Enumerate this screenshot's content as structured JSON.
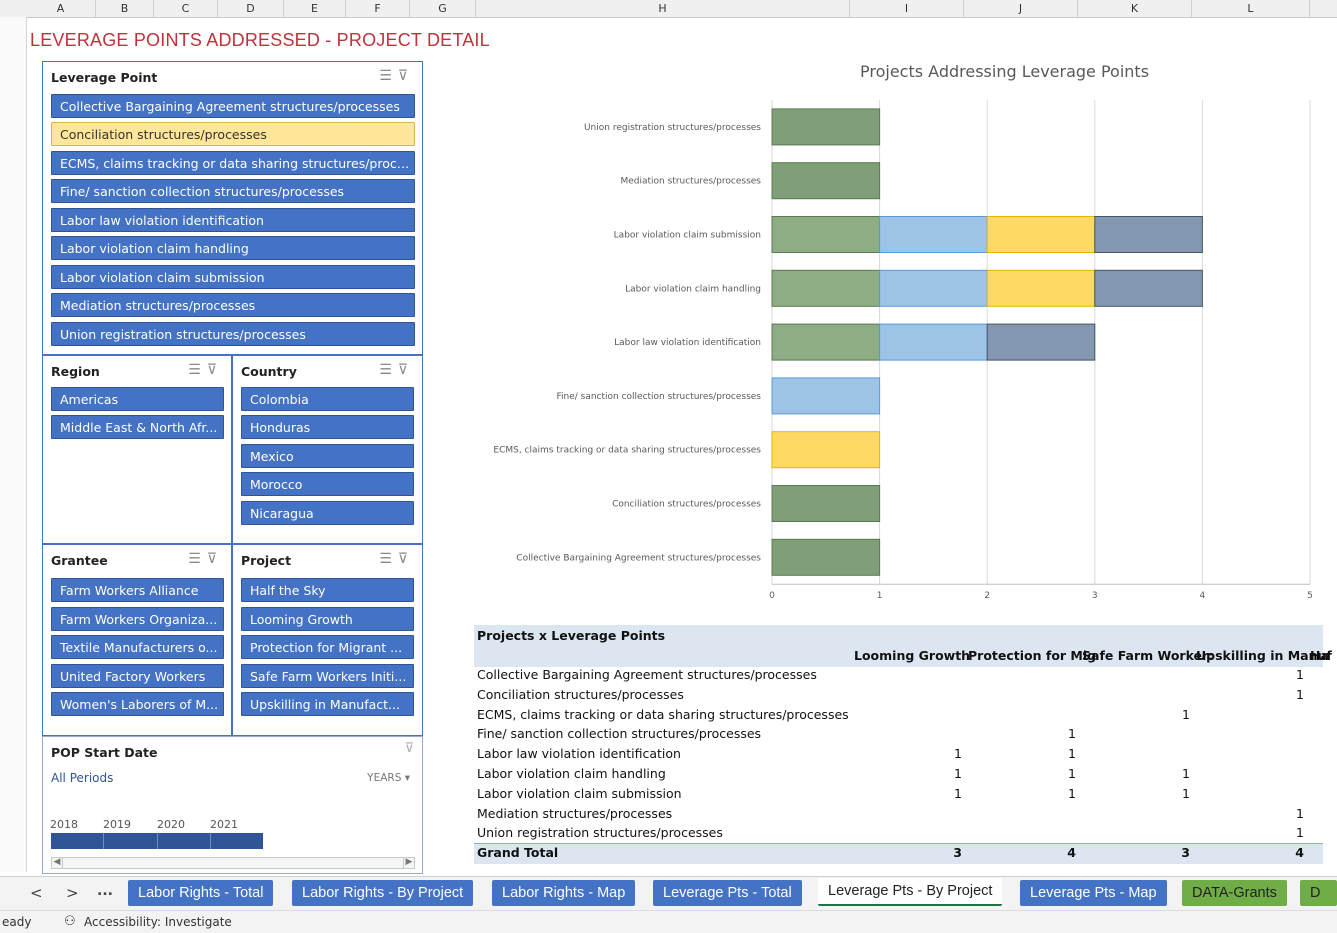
{
  "columns": [
    "A",
    "B",
    "C",
    "D",
    "E",
    "F",
    "G",
    "H",
    "I",
    "J",
    "K",
    "L"
  ],
  "sheet_title": "LEVERAGE POINTS ADDRESSED - PROJECT DETAIL",
  "slicers": {
    "leverage_point": {
      "title": "Leverage Point",
      "items": [
        "Collective Bargaining Agreement structures/processes",
        "Conciliation structures/processes",
        "ECMS, claims tracking or data sharing structures/proce...",
        "Fine/ sanction collection structures/processes",
        "Labor law violation identification",
        "Labor violation claim handling",
        "Labor violation claim submission",
        "Mediation structures/processes",
        "Union registration structures/processes"
      ],
      "selected_index": 1
    },
    "region": {
      "title": "Region",
      "items": [
        "Americas",
        "Middle East & North Afr..."
      ]
    },
    "country": {
      "title": "Country",
      "items": [
        "Colombia",
        "Honduras",
        "Mexico",
        "Morocco",
        "Nicaragua"
      ]
    },
    "grantee": {
      "title": "Grantee",
      "items": [
        "Farm Workers Alliance",
        "Farm Workers Organiza...",
        "Textile Manufacturers o...",
        "United Factory Workers",
        "Women's Laborers of M..."
      ]
    },
    "project": {
      "title": "Project",
      "items": [
        "Half the Sky",
        "Looming Growth",
        "Protection for Migrant ...",
        "Safe Farm Workers Initi...",
        "Upskilling in Manufact..."
      ]
    }
  },
  "timeline": {
    "title": "POP Start Date",
    "period": "All Periods",
    "level": "YEARS",
    "years": [
      "2018",
      "2019",
      "2020",
      "2021"
    ]
  },
  "chart_data": {
    "type": "bar",
    "orientation": "horizontal",
    "stacked": true,
    "title": "Projects Addressing Leverage Points",
    "categories": [
      "Union registration structures/processes",
      "Mediation structures/processes",
      "Labor violation claim submission",
      "Labor violation claim handling",
      "Labor law violation identification",
      "Fine/ sanction collection structures/processes",
      "ECMS, claims tracking or data sharing structures/processes",
      "Conciliation structures/processes",
      "Collective Bargaining Agreement structures/processes"
    ],
    "series": [
      {
        "color": "#8fad84",
        "values": [
          0,
          0,
          1,
          1,
          1,
          0,
          0,
          0,
          0
        ]
      },
      {
        "color": "#9dc3e6",
        "values": [
          0,
          0,
          1,
          1,
          1,
          1,
          0,
          0,
          0
        ]
      },
      {
        "color": "#ffd966",
        "values": [
          0,
          0,
          1,
          1,
          0,
          0,
          1,
          0,
          0
        ]
      },
      {
        "color": "#8497b0",
        "values": [
          0,
          0,
          1,
          1,
          1,
          0,
          0,
          0,
          0
        ]
      },
      {
        "color": "#7f9f78",
        "values": [
          1,
          1,
          0,
          0,
          0,
          0,
          0,
          1,
          1
        ]
      }
    ],
    "xlim": [
      0,
      5
    ],
    "xticks": [
      "0",
      "1",
      "2",
      "3",
      "4",
      "5"
    ],
    "grid": true,
    "legend": "none"
  },
  "pivot": {
    "title": "Projects x Leverage Points",
    "headers": [
      "Looming Growth",
      "Protection for Mig",
      "Safe Farm Worker:",
      "Upskilling in Manuf",
      "Ha"
    ],
    "rows": [
      {
        "label": "Collective Bargaining Agreement structures/processes",
        "values": [
          "",
          "",
          "",
          "1"
        ]
      },
      {
        "label": "Conciliation structures/processes",
        "values": [
          "",
          "",
          "",
          "1"
        ]
      },
      {
        "label": "ECMS, claims tracking or data sharing structures/processes",
        "values": [
          "",
          "",
          "1",
          ""
        ]
      },
      {
        "label": "Fine/ sanction collection structures/processes",
        "values": [
          "",
          "1",
          "",
          ""
        ]
      },
      {
        "label": "Labor law violation identification",
        "values": [
          "1",
          "1",
          "",
          ""
        ]
      },
      {
        "label": "Labor violation claim handling",
        "values": [
          "1",
          "1",
          "1",
          ""
        ]
      },
      {
        "label": "Labor violation claim submission",
        "values": [
          "1",
          "1",
          "1",
          ""
        ]
      },
      {
        "label": "Mediation structures/processes",
        "values": [
          "",
          "",
          "",
          "1"
        ]
      },
      {
        "label": "Union registration structures/processes",
        "values": [
          "",
          "",
          "",
          "1"
        ]
      }
    ],
    "grand_total": {
      "label": "Grand Total",
      "values": [
        "3",
        "4",
        "3",
        "4"
      ]
    }
  },
  "tabs": {
    "nav_prev": "<",
    "nav_next": ">",
    "nav_more": "...",
    "items": [
      {
        "label": "Labor Rights - Total",
        "color": "blue"
      },
      {
        "label": "Labor Rights - By Project",
        "color": "blue"
      },
      {
        "label": "Labor Rights - Map",
        "color": "blue"
      },
      {
        "label": "Leverage Pts - Total",
        "color": "blue"
      },
      {
        "label": "Leverage Pts - By Project",
        "color": "active"
      },
      {
        "label": "Leverage Pts - Map",
        "color": "blue"
      },
      {
        "label": "DATA-Grants",
        "color": "green"
      },
      {
        "label": "D",
        "color": "green"
      }
    ]
  },
  "status": {
    "ready": "eady",
    "accessibility": "Accessibility: Investigate"
  }
}
